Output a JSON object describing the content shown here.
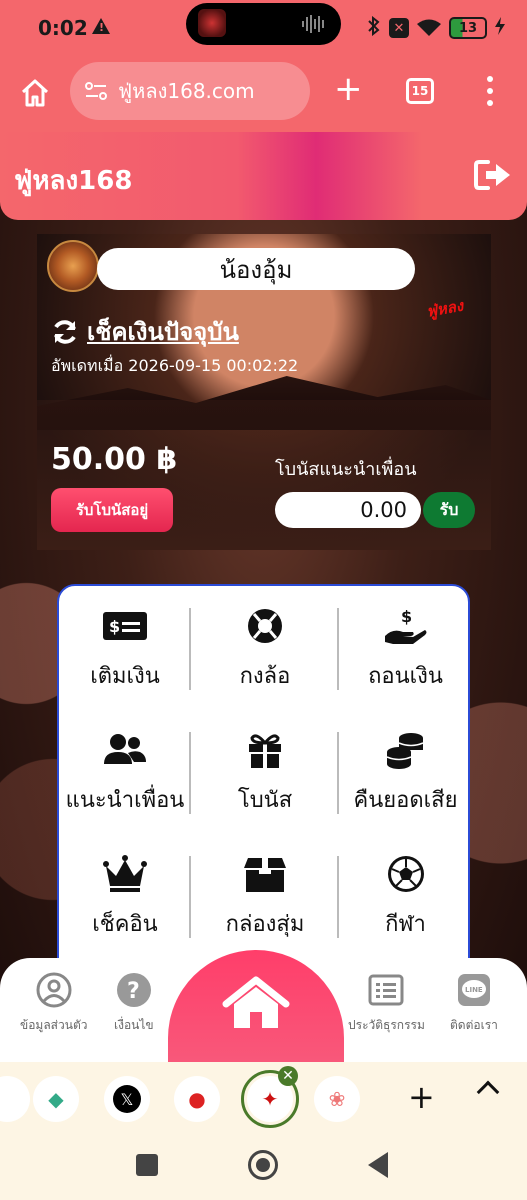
{
  "status_bar": {
    "time": "0:02",
    "battery": "13"
  },
  "browser": {
    "url": "ฟู่หลง168.com",
    "tab_count": "15"
  },
  "site": {
    "title": "ฟู่หลง168"
  },
  "profile": {
    "name": "น้องอุ้ม",
    "check_balance_label": "เช็คเงินปัจจุบัน",
    "updated_text": "อัพเดทเมื่อ 2026-09-15 00:02:22",
    "balance": "50.00 ฿",
    "referral_label": "โบนัสแนะนำเพื่อน",
    "bonus_button": "รับโบนัสอยู่",
    "referral_value": "0.00",
    "claim_button": "รับ"
  },
  "menu": {
    "items": [
      {
        "label": "เติมเงิน",
        "icon": "money-bill-icon"
      },
      {
        "label": "กงล้อ",
        "icon": "lifebuoy-wheel-icon"
      },
      {
        "label": "ถอนเงิน",
        "icon": "hand-dollar-icon"
      },
      {
        "label": "แนะนำเพื่อน",
        "icon": "users-icon"
      },
      {
        "label": "โบนัส",
        "icon": "gift-icon"
      },
      {
        "label": "คืนยอดเสีย",
        "icon": "coins-icon"
      },
      {
        "label": "เช็คอิน",
        "icon": "crown-icon"
      },
      {
        "label": "กล่องสุ่ม",
        "icon": "box-icon"
      },
      {
        "label": "กีฬา",
        "icon": "soccer-ball-icon"
      }
    ]
  },
  "bottom_nav": {
    "profile": "ข้อมูลส่วนตัว",
    "terms": "เงื่อนไข",
    "history": "ประวัติธุรกรรม",
    "contact": "ติดต่อเรา"
  },
  "colors": {
    "primary": "#f4676c",
    "accent": "#e02c75",
    "claim_green": "#0e7a32",
    "menu_border": "#2b4bd6"
  }
}
